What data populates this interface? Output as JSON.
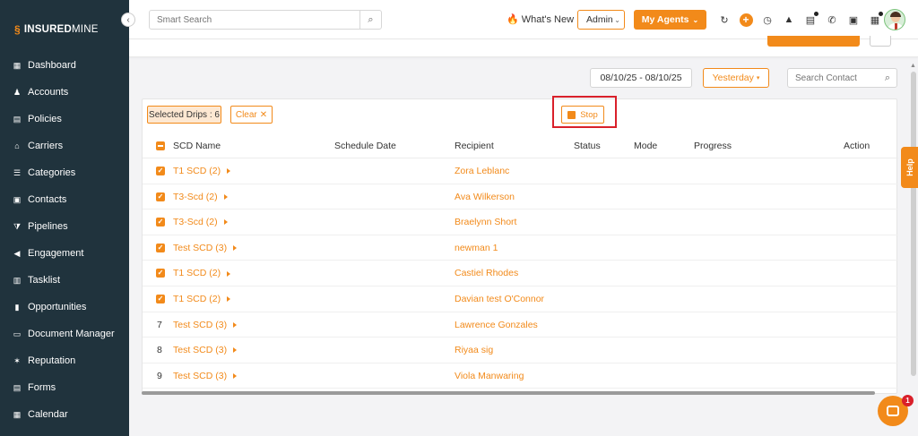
{
  "brand": {
    "logo_bold": "INSURED",
    "logo_light": "MINE"
  },
  "sidebar": {
    "collapse_icon": "chevron-left-icon",
    "items": [
      {
        "label": "Dashboard",
        "icon": "dashboard-icon"
      },
      {
        "label": "Accounts",
        "icon": "accounts-icon"
      },
      {
        "label": "Policies",
        "icon": "policies-icon"
      },
      {
        "label": "Carriers",
        "icon": "carriers-icon"
      },
      {
        "label": "Categories",
        "icon": "categories-icon"
      },
      {
        "label": "Contacts",
        "icon": "contacts-icon"
      },
      {
        "label": "Pipelines",
        "icon": "pipelines-icon"
      },
      {
        "label": "Engagement",
        "icon": "engagement-icon"
      },
      {
        "label": "Tasklist",
        "icon": "tasklist-icon"
      },
      {
        "label": "Opportunities",
        "icon": "opportunities-icon"
      },
      {
        "label": "Document Manager",
        "icon": "folder-icon"
      },
      {
        "label": "Reputation",
        "icon": "reputation-icon"
      },
      {
        "label": "Forms",
        "icon": "forms-icon"
      },
      {
        "label": "Calendar",
        "icon": "calendar-icon"
      }
    ]
  },
  "header": {
    "search_placeholder": "Smart Search",
    "whats_new": "What's New",
    "admin_value": "Admin",
    "my_agents": "My Agents"
  },
  "filters": {
    "date_range": "08/10/25 - 08/10/25",
    "period": "Yesterday",
    "contact_search_placeholder": "Search Contact"
  },
  "toolbar": {
    "selected_drips": "Selected Drips : 6",
    "clear": "Clear",
    "stop": "Stop"
  },
  "table": {
    "columns": [
      "SCD Name",
      "Schedule Date",
      "Recipient",
      "Status",
      "Mode",
      "Progress",
      "Action"
    ],
    "rows": [
      {
        "checked": true,
        "num": "",
        "scd_name": "T1 SCD (2)",
        "recipient": "Zora Leblanc"
      },
      {
        "checked": true,
        "num": "",
        "scd_name": "T3-Scd (2)",
        "recipient": "Ava Wilkerson"
      },
      {
        "checked": true,
        "num": "",
        "scd_name": "T3-Scd (2)",
        "recipient": "Braelynn Short"
      },
      {
        "checked": true,
        "num": "",
        "scd_name": "Test SCD (3)",
        "recipient": "newman 1"
      },
      {
        "checked": true,
        "num": "",
        "scd_name": "T1 SCD (2)",
        "recipient": "Castiel Rhodes"
      },
      {
        "checked": true,
        "num": "",
        "scd_name": "T1 SCD (2)",
        "recipient": "Davian test O'Connor"
      },
      {
        "checked": false,
        "num": "7",
        "scd_name": "Test SCD (3)",
        "recipient": "Lawrence Gonzales"
      },
      {
        "checked": false,
        "num": "8",
        "scd_name": "Test SCD (3)",
        "recipient": "Riyaa sig"
      },
      {
        "checked": false,
        "num": "9",
        "scd_name": "Test SCD (3)",
        "recipient": "Viola Manwaring"
      }
    ]
  },
  "help": {
    "label": "Help"
  },
  "chat": {
    "badge": "1"
  },
  "colors": {
    "accent": "#f28a1a",
    "sidebar": "#20333d",
    "highlight": "#d9202a"
  }
}
